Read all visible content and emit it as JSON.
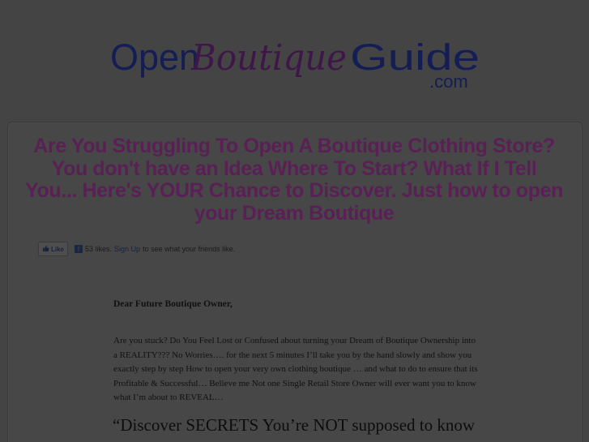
{
  "logo": {
    "open": "Open",
    "boutique": "Boutique",
    "guide": "Guide",
    "dotcom": ".com",
    "colors": {
      "blue": "#141e55",
      "purple": "#3e1748"
    }
  },
  "headline": "Are You Struggling To Open A Boutique Clothing Store? You don't have an Idea Where To Start? What If I Tell You... Here's YOUR Chance to Discover. Just how to open your Dream Boutique",
  "facebook": {
    "like_label": "Like",
    "likes_text": "53 likes.",
    "signup_label": "Sign Up",
    "friends_text": "to see what your friends like."
  },
  "letter": {
    "salutation": "Dear Future Boutique Owner,",
    "paragraph": "Are you stuck? Do You Feel Lost or Confused about turning your Dream of Boutique Ownership into a REALITY??? No Worries…. for the next 5 minutes I’ll take you by the hand slowly and show you exactly step by step How to open your very own clothing boutique … and what to do to ensure that its Profitable & Successful… Believe me Not one Single Retail Store Owner will ever want you to know what I’m about to REVEAL…",
    "subhead": "“Discover SECRETS You’re NOT supposed to know"
  },
  "colors": {
    "background": "#444444",
    "headline": "#5a1f55"
  }
}
